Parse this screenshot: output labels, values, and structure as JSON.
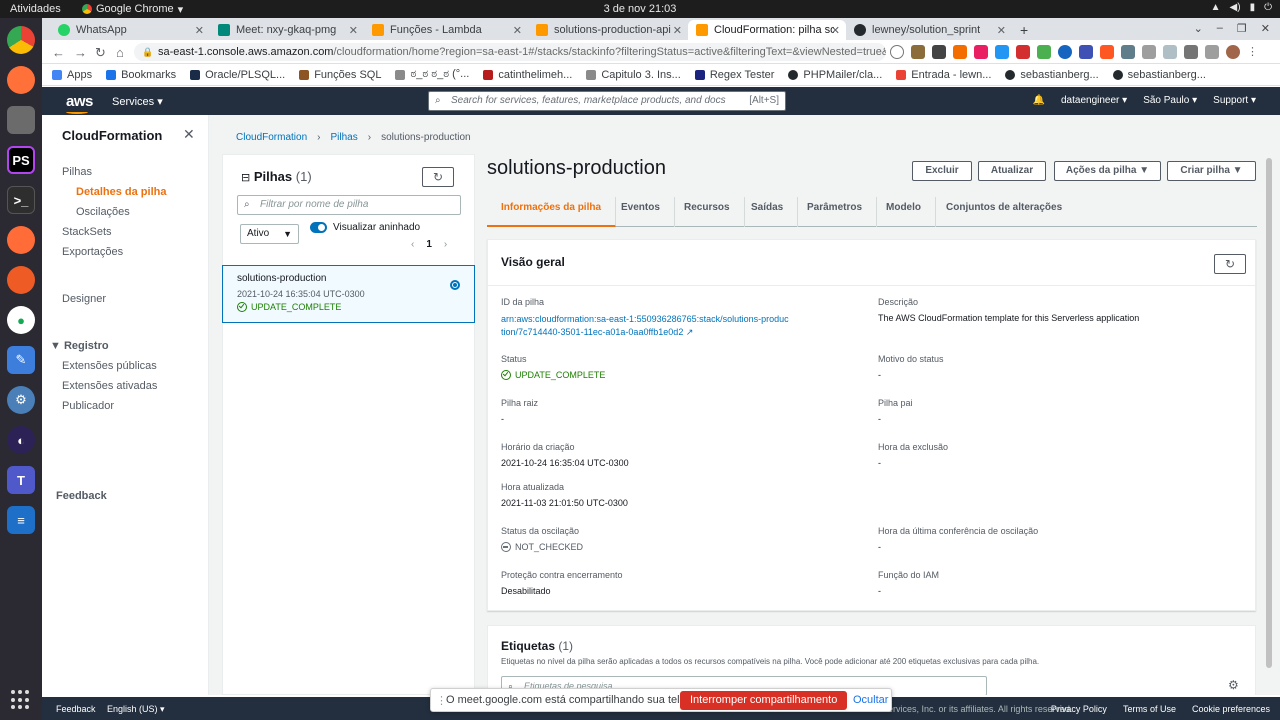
{
  "os": {
    "activities": "Atividades",
    "app_name": "Google Chrome",
    "clock": "3 de nov  21:03"
  },
  "chrome": {
    "tabs": [
      {
        "title": "WhatsApp",
        "color": "#25d366"
      },
      {
        "title": "Meet: nxy-gkaq-pmg",
        "color": "#00897b"
      },
      {
        "title": "Funções - Lambda",
        "color": "#ff9900"
      },
      {
        "title": "solutions-production-api",
        "color": "#ff9900"
      },
      {
        "title": "CloudFormation: pilha so",
        "color": "#ff9900"
      },
      {
        "title": "lewney/solution_sprint",
        "color": "#24292e"
      }
    ],
    "url_host": "sa-east-1.console.aws.amazon.com",
    "url_rest": "/cloudformation/home?region=sa-east-1#/stacks/stackinfo?filteringStatus=active&filteringText=&viewNested=true&hideStacks...",
    "bookmarks": [
      "Apps",
      "Bookmarks",
      "Oracle/PLSQL...",
      "Funções SQL",
      "ಠ_ಠ ಠ_ಠ (°...",
      "catinthelimeh...",
      "Capitulo 3. Ins...",
      "Regex Tester",
      "PHPMailer/cla...",
      "Entrada - lewn...",
      "sebastianberg...",
      "sebastianberg..."
    ]
  },
  "aws": {
    "services": "Services",
    "search_placeholder": "Search for services, features, marketplace products, and docs",
    "search_hotkey": "[Alt+S]",
    "user": "dataengineer",
    "region": "São Paulo",
    "support": "Support"
  },
  "leftnav": {
    "title": "CloudFormation",
    "items": [
      "Pilhas",
      "Detalhes da pilha",
      "Oscilações",
      "StackSets",
      "Exportações",
      "Designer",
      "Registro",
      "Extensões públicas",
      "Extensões ativadas",
      "Publicador",
      "Feedback"
    ]
  },
  "breadcrumb": [
    "CloudFormation",
    "Pilhas",
    "solutions-production"
  ],
  "stacks": {
    "title": "Pilhas",
    "count": "(1)",
    "filter_placeholder": "Filtrar por nome de pilha",
    "status_filter": "Ativo",
    "nested_label": "Visualizar aninhado",
    "page": "1",
    "item": {
      "name": "solutions-production",
      "date": "2021-10-24 16:35:04 UTC-0300",
      "status": "UPDATE_COMPLETE"
    }
  },
  "detail": {
    "title": "solutions-production",
    "buttons": [
      "Excluir",
      "Atualizar",
      "Ações da pilha",
      "Criar pilha"
    ],
    "tabs": [
      "Informações da pilha",
      "Eventos",
      "Recursos",
      "Saídas",
      "Parâmetros",
      "Modelo",
      "Conjuntos de alterações"
    ],
    "overview_title": "Visão geral",
    "fields": {
      "stack_id_label": "ID da pilha",
      "stack_id": "arn:aws:cloudformation:sa-east-1:550936286765:stack/solutions-production/7c714440-3501-11ec-a01a-0aa0ffb1e0d2",
      "description_label": "Descrição",
      "description": "The AWS CloudFormation template for this Serverless application",
      "status_label": "Status",
      "status": "UPDATE_COMPLETE",
      "status_reason_label": "Motivo do status",
      "status_reason": "-",
      "root_label": "Pilha raiz",
      "root": "-",
      "parent_label": "Pilha pai",
      "parent": "-",
      "created_label": "Horário da criação",
      "created": "2021-10-24 16:35:04 UTC-0300",
      "deleted_label": "Hora da exclusão",
      "deleted": "-",
      "updated_label": "Hora atualizada",
      "updated": "2021-11-03 21:01:50 UTC-0300",
      "drift_label": "Status da oscilação",
      "drift": "NOT_CHECKED",
      "drift_check_label": "Hora da última conferência de oscilação",
      "drift_check": "-",
      "termination_label": "Proteção contra encerramento",
      "termination": "Desabilitado",
      "iam_label": "Função do IAM",
      "iam": "-"
    },
    "tags_title": "Etiquetas",
    "tags_count": "(1)",
    "tags_desc": "Etiquetas no nível da pilha serão aplicadas a todos os recursos compatíveis na pilha. Você pode adicionar até 200 etiquetas exclusivas para cada pilha.",
    "tags_search": "Etiquetas de pesquisa"
  },
  "footer": {
    "feedback": "Feedback",
    "language": "English (US)",
    "copyright": "ervices, Inc. or its affiliates. All rights reserved.",
    "links": [
      "Privacy Policy",
      "Terms of Use",
      "Cookie preferences"
    ]
  },
  "share": {
    "message": "O meet.google.com está compartilhando sua tela.",
    "stop": "Interromper compartilhamento",
    "hide": "Ocultar"
  }
}
